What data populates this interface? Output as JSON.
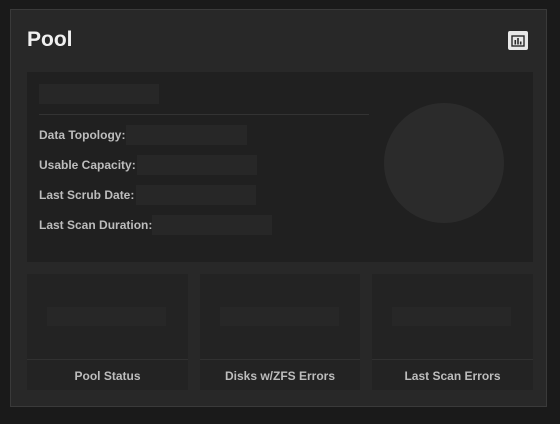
{
  "widget": {
    "title": "Pool",
    "chart_button_icon": "bar-chart-icon"
  },
  "details": {
    "rows": [
      {
        "label": "Data Topology:"
      },
      {
        "label": "Usable Capacity:"
      },
      {
        "label": "Last Scrub Date:"
      },
      {
        "label": "Last Scan Duration:"
      }
    ]
  },
  "stats": [
    {
      "label": "Pool Status"
    },
    {
      "label": "Disks w/ZFS Errors"
    },
    {
      "label": "Last Scan Errors"
    }
  ],
  "colors": {
    "page_background": "#1a1a1a",
    "card_background": "#282828",
    "panel_background": "#202020",
    "skeleton": "#272727",
    "text": "#bdbdbd",
    "title": "#f0f0f0"
  }
}
